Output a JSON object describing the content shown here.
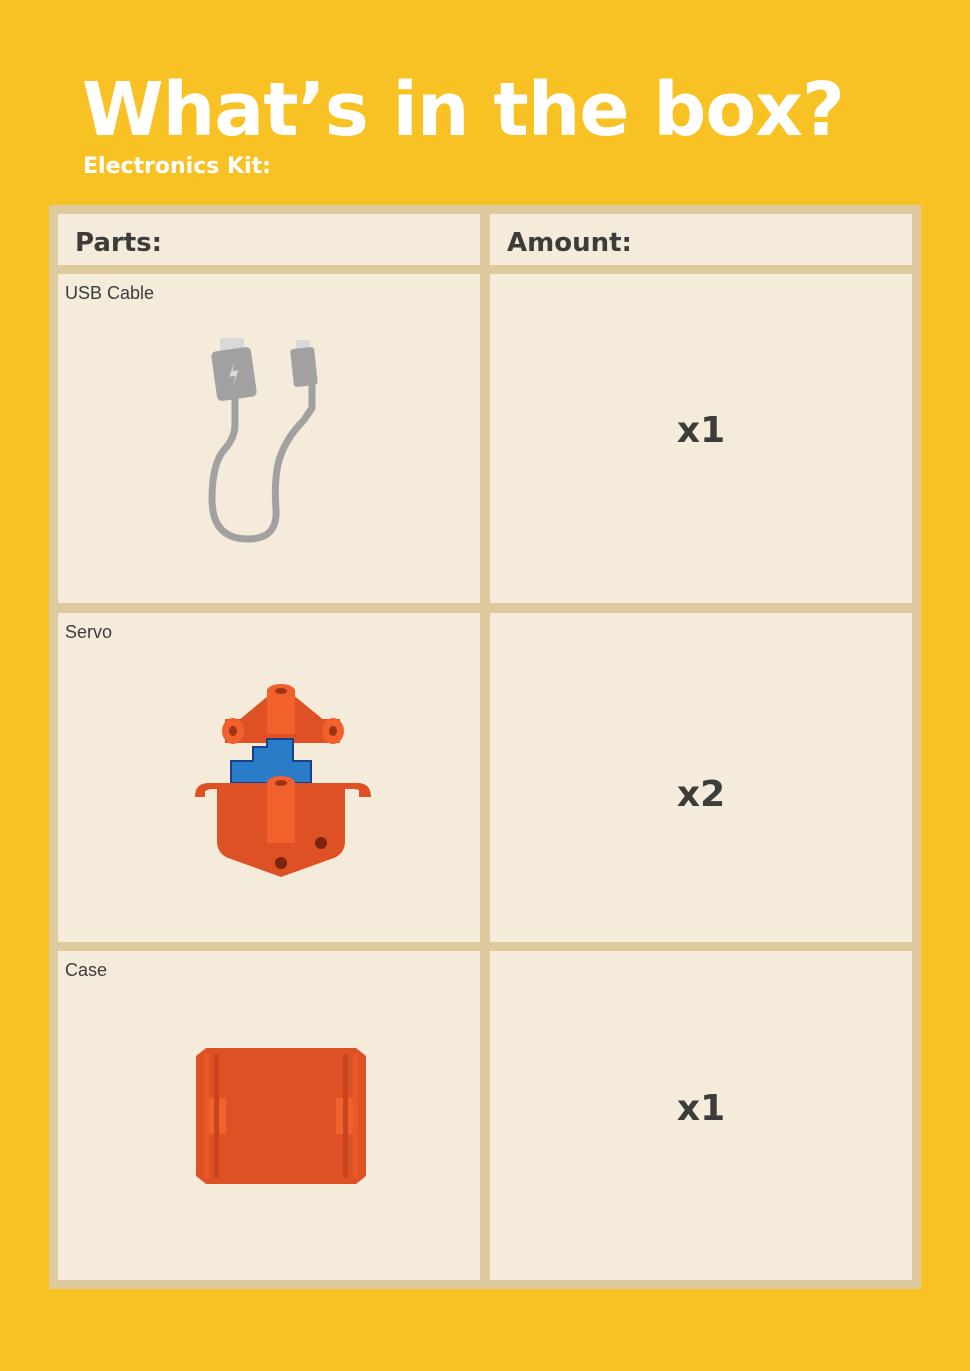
{
  "header": {
    "title": "What’s in the box?",
    "subtitle": "Electronics Kit:"
  },
  "table": {
    "columns": [
      "Parts:",
      "Amount:"
    ],
    "rows": [
      {
        "part": "USB Cable",
        "amount": "x1",
        "icon": "usb-cable-icon"
      },
      {
        "part": "Servo",
        "amount": "x2",
        "icon": "servo-icon"
      },
      {
        "part": "Case",
        "amount": "x1",
        "icon": "case-icon"
      }
    ]
  },
  "colors": {
    "background": "#f9c224",
    "table_border": "#dfc99e",
    "cell": "#f4ebdb",
    "text_dark": "#3c3c3a",
    "orange": "#de5125",
    "orange_light": "#f2602c",
    "blue": "#2a7cc7",
    "cable_gray": "#a1a1a1"
  }
}
